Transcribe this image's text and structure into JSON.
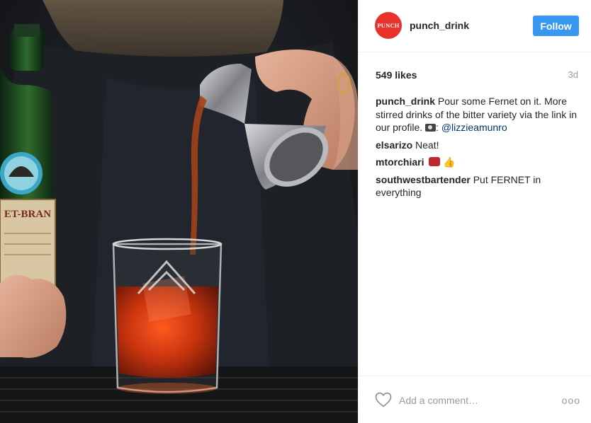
{
  "post": {
    "account": {
      "avatar_text": "PUNCH",
      "username": "punch_drink",
      "follow_label": "Follow"
    },
    "likes": "549 likes",
    "time": "3d",
    "comments": [
      {
        "user": "punch_drink",
        "text": "Pour some Fernet on it. More stirred drinks of the bitter variety via the link in our profile.",
        "after_icon": ": ",
        "mention": "@lizzieamunro"
      },
      {
        "user": "elsarizo",
        "text": "Neat!"
      },
      {
        "user": "mtorchiari",
        "text": ""
      },
      {
        "user": "southwestbartender",
        "text": "Put FERNET in everything"
      }
    ],
    "add_comment_placeholder": "Add a comment…",
    "more_label": "ooo"
  },
  "photo": {
    "label_text": "ET-BRAN"
  },
  "colors": {
    "follow": "#3897f0",
    "avatar": "#e8322b",
    "mention": "#003569",
    "muted": "#999999"
  },
  "icons": [
    "heart-icon",
    "camera-icon",
    "emoji-icon",
    "thumbs-up-icon",
    "more-options-icon"
  ]
}
